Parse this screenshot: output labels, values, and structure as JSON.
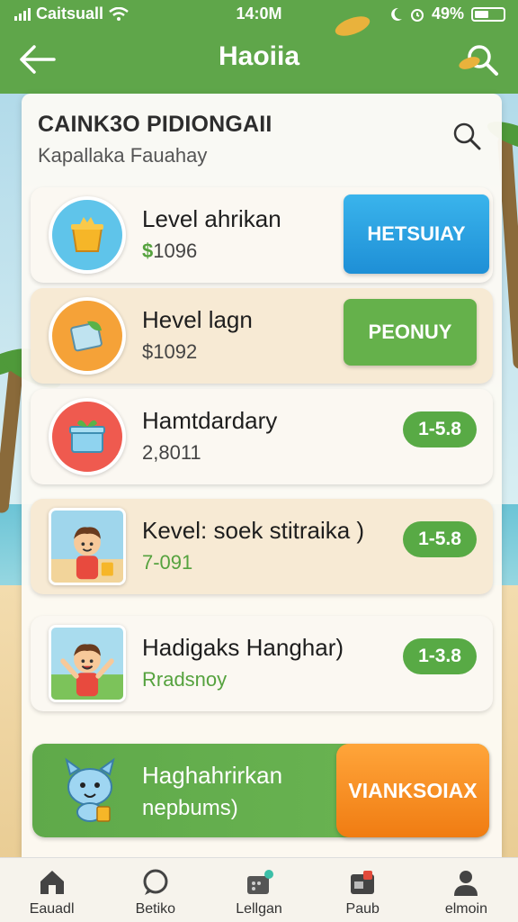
{
  "status_bar": {
    "carrier": "Caitsuall",
    "time": "14:0M",
    "battery": "49%",
    "battery_level": 0.49
  },
  "header": {
    "title": "Haoiia"
  },
  "panel": {
    "heading": "CAINK3O PIDIONGAII",
    "subheading": "Kapallaka Fauahay"
  },
  "items": [
    {
      "name": "Level ahrikan",
      "value_prefix": "$",
      "value": "1096",
      "action": "HETSUIAY",
      "icon": "bucket-icon"
    },
    {
      "name": "Hevel lagn",
      "value_prefix": "",
      "value": "$1092",
      "action": "PEONUY",
      "icon": "leaf-card-icon"
    },
    {
      "name": "Hamtdardary",
      "value": "2,8011",
      "badge": "1-5.8",
      "icon": "gift-box-icon"
    },
    {
      "name": "Kevel: soek stitraika )",
      "value": "7-091",
      "badge": "1-5.8",
      "icon": "boy-avatar-icon"
    },
    {
      "name": "Hadigaks Hanghar)",
      "value": "Rradsnoy",
      "badge": "1-3.8",
      "icon": "cheering-boy-icon"
    }
  ],
  "promo": {
    "line1": "Haghahrirkan",
    "line2": "nepbums)",
    "action": "VIANKSOIAX",
    "icon": "mascot-icon"
  },
  "tabs": [
    {
      "label": "Eauadl",
      "icon": "home-icon"
    },
    {
      "label": "Betiko",
      "icon": "chat-icon"
    },
    {
      "label": "Lellgan",
      "icon": "store-icon"
    },
    {
      "label": "Paub",
      "icon": "wallet-icon"
    },
    {
      "label": "elmoin",
      "icon": "profile-icon"
    }
  ],
  "colors": {
    "brand_green": "#5fa64a",
    "accent_blue": "#1e8fd6",
    "accent_orange": "#f07c12"
  }
}
